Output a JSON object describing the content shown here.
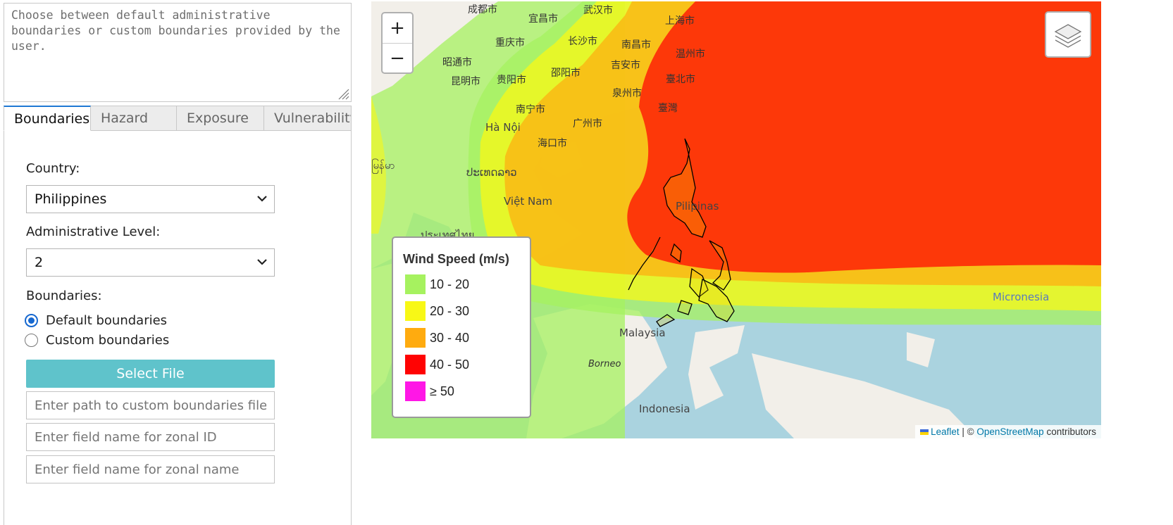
{
  "description": {
    "text": "Choose between default administrative boundaries or custom boundaries provided by the user."
  },
  "tabs": [
    {
      "label": "Boundaries",
      "active": true
    },
    {
      "label": "Hazard",
      "active": false
    },
    {
      "label": "Exposure",
      "active": false
    },
    {
      "label": "Vulnerability",
      "active": false
    }
  ],
  "boundaries_form": {
    "country_label": "Country:",
    "country_value": "Philippines",
    "admin_level_label": "Administrative Level:",
    "admin_level_value": "2",
    "boundaries_label": "Boundaries:",
    "radio_default": "Default boundaries",
    "radio_custom": "Custom boundaries",
    "selected_boundary": "default",
    "select_file_button": "Select File",
    "path_placeholder": "Enter path to custom boundaries file",
    "zonal_id_placeholder": "Enter field name for zonal ID",
    "zonal_name_placeholder": "Enter field name for zonal name"
  },
  "map": {
    "zoom_in": "+",
    "zoom_out": "−",
    "labels": {
      "chengdu": "成都市",
      "yichang": "宜昌市",
      "wuhan": "武汉市",
      "shanghai": "上海市",
      "chongqing": "重庆市",
      "changsha": "长沙市",
      "nanchang": "南昌市",
      "wenzhou": "温州市",
      "zhaotong": "昭通市",
      "shaoyang": "邵阳市",
      "jian": "吉安市",
      "kunming": "昆明市",
      "guiyang": "贵阳市",
      "taibei": "臺北市",
      "quanzhou": "泉州市",
      "taiwan": "臺灣",
      "nanning": "南宁市",
      "guangzhou": "广州市",
      "hanoi": "Hà Nội",
      "haikou": "海口市",
      "laos": "ປະເທດລາວ",
      "vietnam": "Việt Nam",
      "thailand": "ประเทศไทย",
      "myanmar": "မြန်မာ",
      "pilipinas": "Pilipinas",
      "micronesia": "Micronesia",
      "malaysia": "Malaysia",
      "borneo": "Borneo",
      "indonesia": "Indonesia"
    },
    "legend": {
      "title": "Wind Speed (m/s)",
      "items": [
        {
          "label": "10 - 20",
          "color": "#a6f25f"
        },
        {
          "label": "20 - 30",
          "color": "#f8f816"
        },
        {
          "label": "30 - 40",
          "color": "#ffab0f"
        },
        {
          "label": "40 - 50",
          "color": "#ff0303"
        },
        {
          "label": "≥ 50",
          "color": "#ff17e6"
        }
      ]
    },
    "attribution": {
      "leaflet": "Leaflet",
      "sep": "| ©",
      "osm": "OpenStreetMap",
      "contributors": "contributors"
    }
  }
}
